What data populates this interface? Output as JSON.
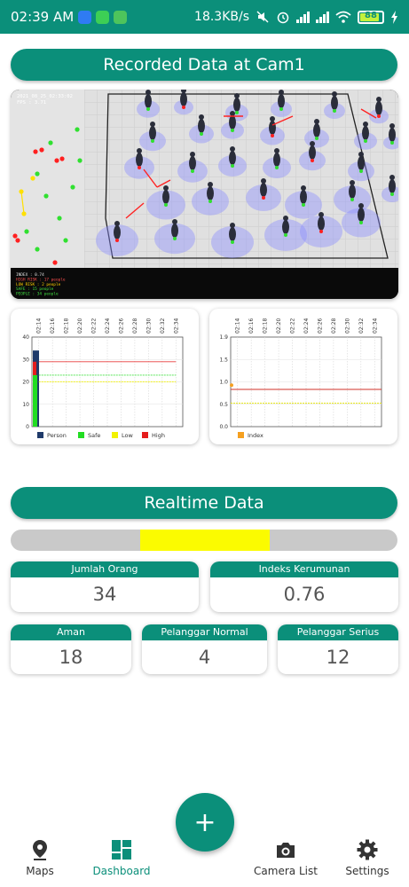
{
  "status_bar": {
    "time": "02:39 AM",
    "network_speed": "18.3KB/s",
    "battery_level": "88",
    "battery_fraction": 0.88
  },
  "recorded": {
    "title": "Recorded Data at Cam1",
    "camera": {
      "timestamp": "2021_08_25_02:33:02",
      "fps": "FPS : 3.71",
      "legend_lines": [
        {
          "text": "INDEX : 0.74",
          "color": "#e0e0e0"
        },
        {
          "text": "HIGH RISK : 17 people",
          "color": "#ff5050"
        },
        {
          "text": "LOW RISK : 2 people",
          "color": "#ffd000"
        },
        {
          "text": "SAFE : 15 people",
          "color": "#40e040"
        },
        {
          "text": "PEOPLE : 34 people",
          "color": "#40e040"
        }
      ]
    }
  },
  "chart_data": [
    {
      "type": "area",
      "x": [
        "02:14",
        "02:16",
        "02:18",
        "02:20",
        "02:22",
        "02:24",
        "02:26",
        "02:28",
        "02:30",
        "02:32",
        "02:34"
      ],
      "ylim": [
        0,
        40
      ],
      "yticks": [
        "40",
        "30",
        "20",
        "10",
        "0"
      ],
      "series": [
        {
          "name": "Person",
          "color": "#1f3a6a",
          "values": [
            34,
            34,
            34,
            34,
            34,
            34,
            34,
            34,
            34,
            34,
            34
          ]
        },
        {
          "name": "Safe",
          "color": "#22dd22",
          "values": [
            23,
            23,
            23,
            23,
            23,
            23,
            23,
            23,
            23,
            23,
            23
          ]
        },
        {
          "name": "Low",
          "color": "#f2f200",
          "values": [
            20,
            20,
            20,
            20,
            20,
            20,
            20,
            20,
            20,
            20,
            20
          ]
        },
        {
          "name": "High",
          "color": "#e51c1c",
          "values": [
            29,
            29,
            29,
            29,
            29,
            29,
            29,
            29,
            29,
            29,
            29
          ]
        }
      ]
    },
    {
      "type": "line",
      "x": [
        "02:14",
        "02:16",
        "02:18",
        "02:20",
        "02:22",
        "02:24",
        "02:26",
        "02:28",
        "02:30",
        "02:32",
        "02:34"
      ],
      "ylim": [
        0,
        1.9
      ],
      "yticks": [
        "1.9",
        "1.5",
        "1.0",
        "0.5",
        "0.0"
      ],
      "series": [
        {
          "name": "Index",
          "color": "#f5a020",
          "values": [
            0.88,
            0.88,
            0.88,
            0.88,
            0.88,
            0.88,
            0.88,
            0.88,
            0.88,
            0.88,
            0.88
          ]
        }
      ],
      "reference_lines": [
        {
          "value": 0.79,
          "color": "#d0302a"
        },
        {
          "value": 0.5,
          "color": "#e6e600"
        }
      ]
    }
  ],
  "realtime": {
    "title": "Realtime Data",
    "level_segment": {
      "start": 0.335,
      "end": 0.67,
      "color": "#fbfb00"
    },
    "jumlah_orang": {
      "label": "Jumlah Orang",
      "value": "34"
    },
    "indeks_kerumunan": {
      "label": "Indeks Kerumunan",
      "value": "0.76"
    },
    "aman": {
      "label": "Aman",
      "value": "18"
    },
    "pelanggar_normal": {
      "label": "Pelanggar Normal",
      "value": "4"
    },
    "pelanggar_serius": {
      "label": "Pelanggar Serius",
      "value": "12"
    }
  },
  "fab": {
    "label": "+"
  },
  "nav": {
    "maps": "Maps",
    "dashboard": "Dashboard",
    "camera_list": "Camera List",
    "settings": "Settings"
  },
  "colors": {
    "primary": "#0b8f7a"
  }
}
